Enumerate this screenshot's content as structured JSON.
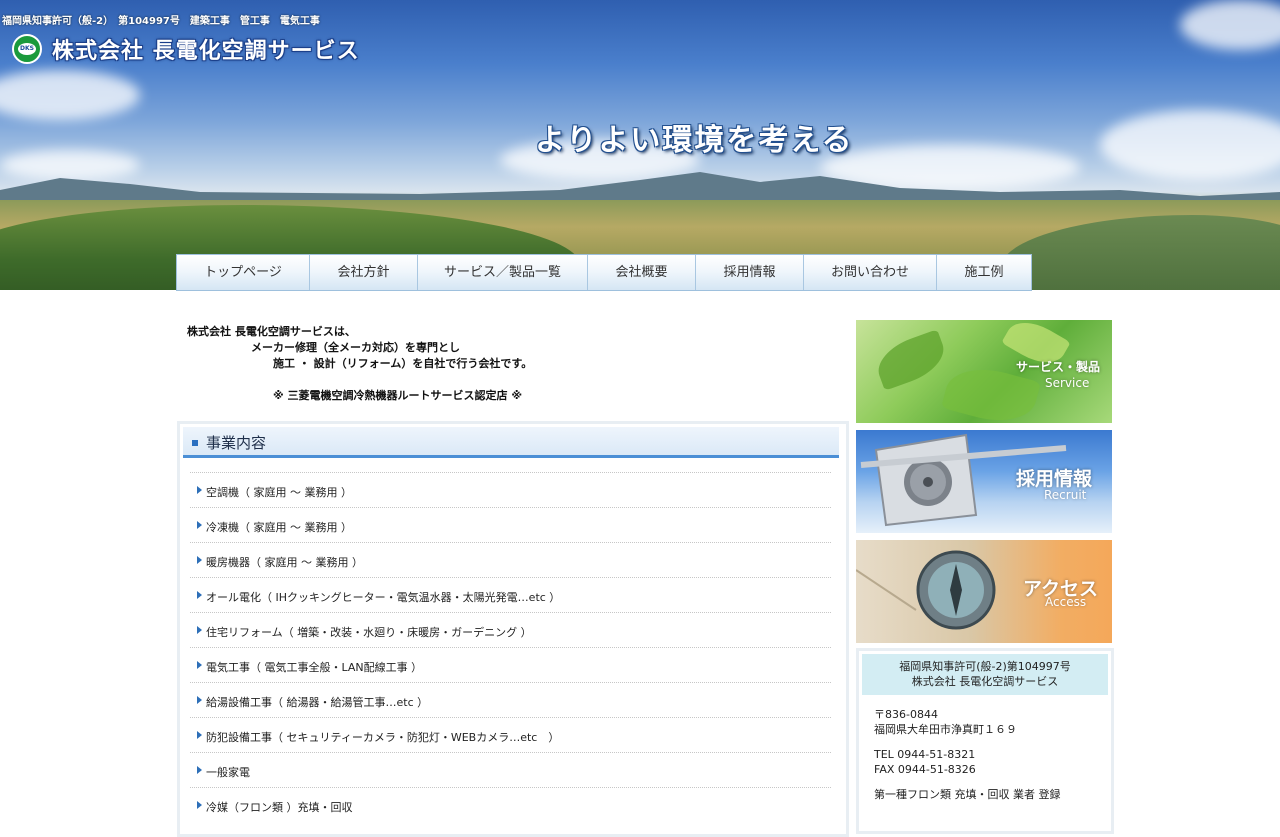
{
  "header": {
    "license_line": "福岡県知事許可（般-2）　第104997号　建築工事　管工事　電気工事",
    "logo_badge": "DKS",
    "company_name": "株式会社 長電化空調サービス",
    "tagline": "よりよい環境を考える"
  },
  "nav": {
    "items": [
      {
        "label": "トップページ"
      },
      {
        "label": "会社方針"
      },
      {
        "label": "サービス／製品一覧"
      },
      {
        "label": "会社概要"
      },
      {
        "label": "採用情報"
      },
      {
        "label": "お問い合わせ"
      },
      {
        "label": "施工例"
      }
    ]
  },
  "intro": {
    "line1": "株式会社 長電化空調サービスは、",
    "line2": "メーカー修理（全メーカ対応）を専門とし",
    "line3": "施工 ・ 設計（リフォーム）を自社で行う会社です。",
    "line4": "※ 三菱電機空調冷熱機器ルートサービス認定店 ※"
  },
  "business": {
    "title": "事業内容",
    "items": [
      {
        "label": "空調機（ 家庭用 ～ 業務用 ）"
      },
      {
        "label": "冷凍機（ 家庭用 ～ 業務用 ）"
      },
      {
        "label": "暖房機器（ 家庭用 ～ 業務用 ）"
      },
      {
        "label": "オール電化（ IHクッキングヒーター・電気温水器・太陽光発電…etc ）"
      },
      {
        "label": "住宅リフォーム（ 増築・改装・水廻り・床暖房・ガーデニング ）"
      },
      {
        "label": "電気工事（ 電気工事全般・LAN配線工事 ）"
      },
      {
        "label": "給湯設備工事（ 給湯器・給湯管工事…etc ）"
      },
      {
        "label": "防犯設備工事（ セキュリティーカメラ・防犯灯・WEBカメラ…etc　）"
      },
      {
        "label": "一般家電"
      },
      {
        "label": "冷媒（フロン類 ）充填・回収"
      }
    ]
  },
  "sidebar": {
    "banners": [
      {
        "jp": "サービス・製品",
        "en": "Service"
      },
      {
        "jp": "採用情報",
        "en": "Recruit"
      },
      {
        "jp": "アクセス",
        "en": "Access"
      }
    ],
    "info": {
      "head1": "福岡県知事許可(般-2)第104997号",
      "head2": "株式会社 長電化空調サービス",
      "postal": "〒836-0844",
      "address": "福岡県大牟田市浄真町１６９",
      "tel": "TEL 0944-51-8321",
      "fax": "FAX 0944-51-8326",
      "freon": "第一種フロン類 充填・回収 業者 登録"
    }
  },
  "colors": {
    "nav_border": "#9ec0dd",
    "section_accent": "#4b8fd6",
    "bullet": "#2d6fb8",
    "info_head_bg": "#d3edf3"
  }
}
